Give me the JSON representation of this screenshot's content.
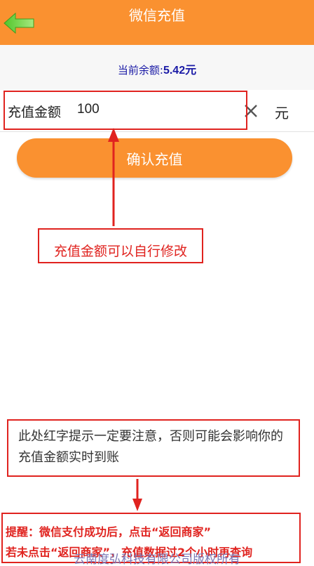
{
  "header": {
    "title": "微信充值",
    "back_icon": "green-back-arrow-icon"
  },
  "balance": {
    "label": "当前余额:",
    "value": "5.42元"
  },
  "amount": {
    "label": "充值金额",
    "value": "100",
    "unit": "元",
    "clear_icon": "close-icon"
  },
  "confirm_button": "确认充值",
  "annotations": {
    "editable_note": "充值金额可以自行修改",
    "warning_note": "此处红字提示一定要注意，否则可能会影响你的充值金额实时到账"
  },
  "reminder": {
    "line1": "提醒：微信支付成功后，点击“返回商家”",
    "line2": "若未点击“返回商家”，充值数据过2个小时再查询"
  },
  "footer": "云南度弘科技有限公司版权所有",
  "colors": {
    "accent": "#fa9130",
    "annotation_red": "#e0231f",
    "balance_blue": "#1a1aa6"
  }
}
